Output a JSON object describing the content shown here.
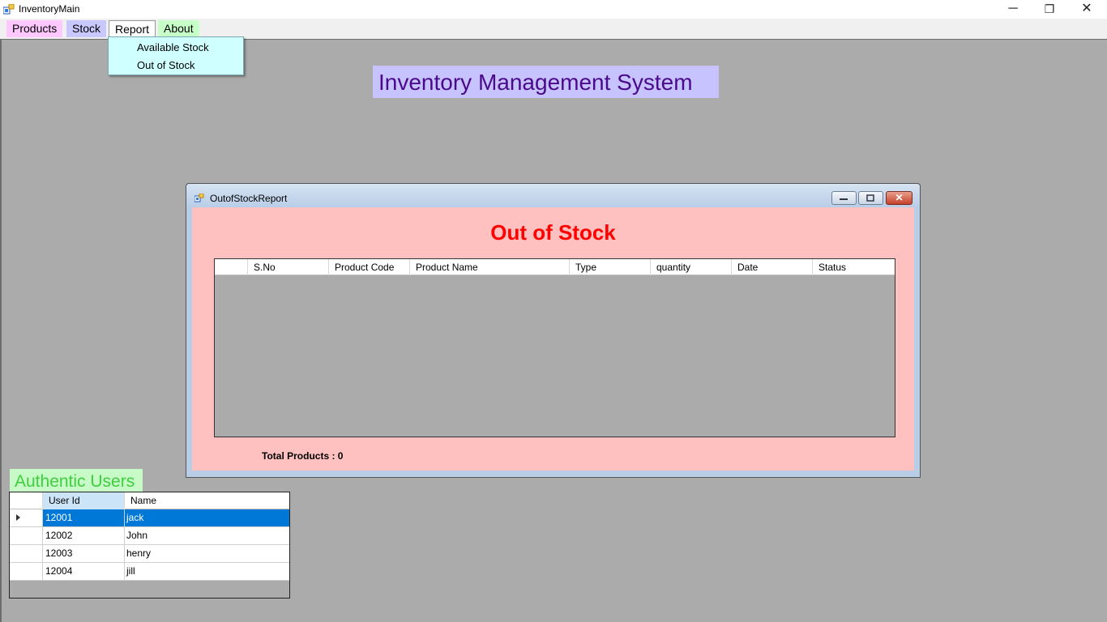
{
  "window": {
    "title": "InventoryMain",
    "minimize": "─",
    "restore": "❐",
    "close": "✕"
  },
  "menu": {
    "items": [
      {
        "label": "Products",
        "color": "#ffc8ff"
      },
      {
        "label": "Stock",
        "color": "#c8c8ff"
      },
      {
        "label": "Report",
        "color": "#ffffff"
      },
      {
        "label": "About",
        "color": "#c8ffc8"
      }
    ],
    "report_dropdown": [
      "Available Stock",
      "Out of Stock"
    ]
  },
  "main_title": "Inventory Management System",
  "report_window": {
    "title": "OutofStockReport",
    "heading": "Out of Stock",
    "columns": [
      "S.No",
      "Product Code",
      "Product Name",
      "Type",
      "quantity",
      "Date",
      "Status"
    ],
    "rows": [],
    "total_label": "Total Products : 0",
    "close_glyph": "✕"
  },
  "users": {
    "title": "Authentic Users",
    "columns": [
      "User Id",
      "Name"
    ],
    "rows": [
      {
        "id": "12001",
        "name": "jack",
        "selected": true
      },
      {
        "id": "12002",
        "name": "John",
        "selected": false
      },
      {
        "id": "12003",
        "name": "henry",
        "selected": false
      },
      {
        "id": "12004",
        "name": "jill",
        "selected": false
      }
    ]
  },
  "colors": {
    "mdi_background": "#ababab",
    "title_bg": "#c6c3ff",
    "title_text": "#4b0a8c",
    "report_bg": "#ffc0c0",
    "heading_red": "#ff0000",
    "users_title_bg": "#c8fac8",
    "users_title_text": "#3ecf3e",
    "selection": "#0078d7"
  }
}
